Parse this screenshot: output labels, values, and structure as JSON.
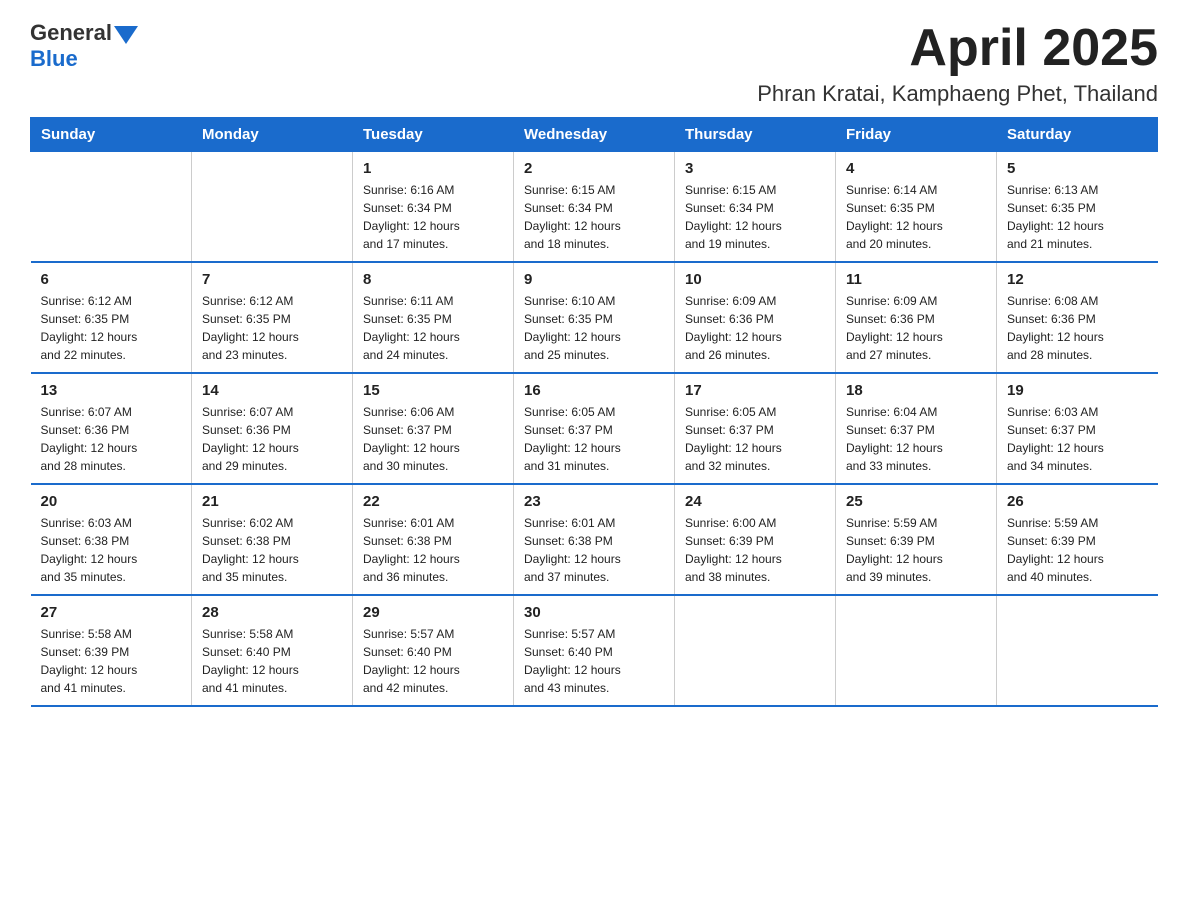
{
  "header": {
    "logo": {
      "general": "General",
      "blue": "Blue"
    },
    "month": "April 2025",
    "location": "Phran Kratai, Kamphaeng Phet, Thailand"
  },
  "weekdays": [
    "Sunday",
    "Monday",
    "Tuesday",
    "Wednesday",
    "Thursday",
    "Friday",
    "Saturday"
  ],
  "weeks": [
    [
      {
        "day": "",
        "info": ""
      },
      {
        "day": "",
        "info": ""
      },
      {
        "day": "1",
        "info": "Sunrise: 6:16 AM\nSunset: 6:34 PM\nDaylight: 12 hours\nand 17 minutes."
      },
      {
        "day": "2",
        "info": "Sunrise: 6:15 AM\nSunset: 6:34 PM\nDaylight: 12 hours\nand 18 minutes."
      },
      {
        "day": "3",
        "info": "Sunrise: 6:15 AM\nSunset: 6:34 PM\nDaylight: 12 hours\nand 19 minutes."
      },
      {
        "day": "4",
        "info": "Sunrise: 6:14 AM\nSunset: 6:35 PM\nDaylight: 12 hours\nand 20 minutes."
      },
      {
        "day": "5",
        "info": "Sunrise: 6:13 AM\nSunset: 6:35 PM\nDaylight: 12 hours\nand 21 minutes."
      }
    ],
    [
      {
        "day": "6",
        "info": "Sunrise: 6:12 AM\nSunset: 6:35 PM\nDaylight: 12 hours\nand 22 minutes."
      },
      {
        "day": "7",
        "info": "Sunrise: 6:12 AM\nSunset: 6:35 PM\nDaylight: 12 hours\nand 23 minutes."
      },
      {
        "day": "8",
        "info": "Sunrise: 6:11 AM\nSunset: 6:35 PM\nDaylight: 12 hours\nand 24 minutes."
      },
      {
        "day": "9",
        "info": "Sunrise: 6:10 AM\nSunset: 6:35 PM\nDaylight: 12 hours\nand 25 minutes."
      },
      {
        "day": "10",
        "info": "Sunrise: 6:09 AM\nSunset: 6:36 PM\nDaylight: 12 hours\nand 26 minutes."
      },
      {
        "day": "11",
        "info": "Sunrise: 6:09 AM\nSunset: 6:36 PM\nDaylight: 12 hours\nand 27 minutes."
      },
      {
        "day": "12",
        "info": "Sunrise: 6:08 AM\nSunset: 6:36 PM\nDaylight: 12 hours\nand 28 minutes."
      }
    ],
    [
      {
        "day": "13",
        "info": "Sunrise: 6:07 AM\nSunset: 6:36 PM\nDaylight: 12 hours\nand 28 minutes."
      },
      {
        "day": "14",
        "info": "Sunrise: 6:07 AM\nSunset: 6:36 PM\nDaylight: 12 hours\nand 29 minutes."
      },
      {
        "day": "15",
        "info": "Sunrise: 6:06 AM\nSunset: 6:37 PM\nDaylight: 12 hours\nand 30 minutes."
      },
      {
        "day": "16",
        "info": "Sunrise: 6:05 AM\nSunset: 6:37 PM\nDaylight: 12 hours\nand 31 minutes."
      },
      {
        "day": "17",
        "info": "Sunrise: 6:05 AM\nSunset: 6:37 PM\nDaylight: 12 hours\nand 32 minutes."
      },
      {
        "day": "18",
        "info": "Sunrise: 6:04 AM\nSunset: 6:37 PM\nDaylight: 12 hours\nand 33 minutes."
      },
      {
        "day": "19",
        "info": "Sunrise: 6:03 AM\nSunset: 6:37 PM\nDaylight: 12 hours\nand 34 minutes."
      }
    ],
    [
      {
        "day": "20",
        "info": "Sunrise: 6:03 AM\nSunset: 6:38 PM\nDaylight: 12 hours\nand 35 minutes."
      },
      {
        "day": "21",
        "info": "Sunrise: 6:02 AM\nSunset: 6:38 PM\nDaylight: 12 hours\nand 35 minutes."
      },
      {
        "day": "22",
        "info": "Sunrise: 6:01 AM\nSunset: 6:38 PM\nDaylight: 12 hours\nand 36 minutes."
      },
      {
        "day": "23",
        "info": "Sunrise: 6:01 AM\nSunset: 6:38 PM\nDaylight: 12 hours\nand 37 minutes."
      },
      {
        "day": "24",
        "info": "Sunrise: 6:00 AM\nSunset: 6:39 PM\nDaylight: 12 hours\nand 38 minutes."
      },
      {
        "day": "25",
        "info": "Sunrise: 5:59 AM\nSunset: 6:39 PM\nDaylight: 12 hours\nand 39 minutes."
      },
      {
        "day": "26",
        "info": "Sunrise: 5:59 AM\nSunset: 6:39 PM\nDaylight: 12 hours\nand 40 minutes."
      }
    ],
    [
      {
        "day": "27",
        "info": "Sunrise: 5:58 AM\nSunset: 6:39 PM\nDaylight: 12 hours\nand 41 minutes."
      },
      {
        "day": "28",
        "info": "Sunrise: 5:58 AM\nSunset: 6:40 PM\nDaylight: 12 hours\nand 41 minutes."
      },
      {
        "day": "29",
        "info": "Sunrise: 5:57 AM\nSunset: 6:40 PM\nDaylight: 12 hours\nand 42 minutes."
      },
      {
        "day": "30",
        "info": "Sunrise: 5:57 AM\nSunset: 6:40 PM\nDaylight: 12 hours\nand 43 minutes."
      },
      {
        "day": "",
        "info": ""
      },
      {
        "day": "",
        "info": ""
      },
      {
        "day": "",
        "info": ""
      }
    ]
  ]
}
